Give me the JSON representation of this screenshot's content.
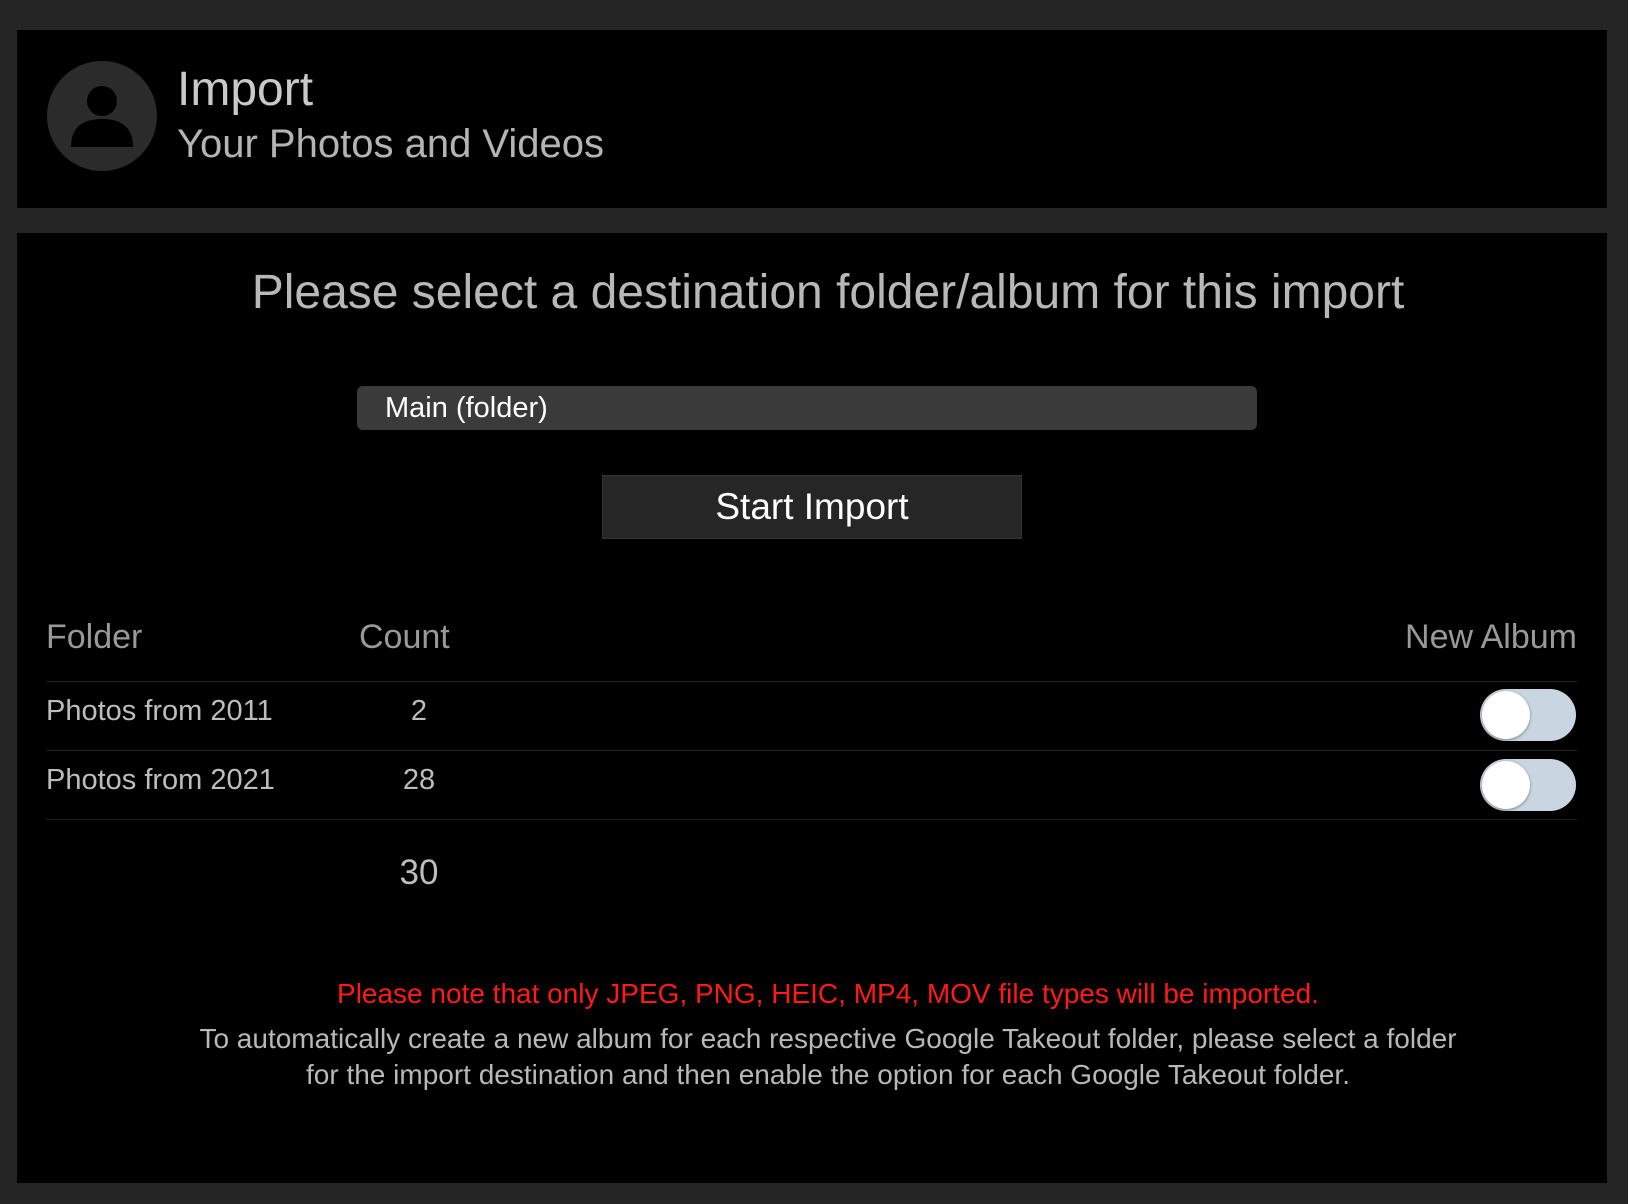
{
  "header": {
    "title": "Import",
    "subtitle": "Your Photos and Videos",
    "avatar_icon": "user-icon"
  },
  "main": {
    "prompt": "Please select a destination folder/album for this import",
    "destination": {
      "selected": "Main (folder)"
    },
    "start_button_label": "Start Import",
    "table": {
      "columns": [
        "Folder",
        "Count",
        "New Album"
      ],
      "rows": [
        {
          "folder": "Photos from 2011",
          "count": "2",
          "new_album": false
        },
        {
          "folder": "Photos from 2021",
          "count": "28",
          "new_album": false
        }
      ],
      "total": "30"
    },
    "warning": "Please note that only JPEG, PNG, HEIC, MP4, MOV file types will be imported.",
    "hint_lines": [
      "To automatically create a new album for each respective Google Takeout folder, please select a folder",
      "for the import destination and then enable the option for each Google Takeout folder."
    ]
  },
  "colors": {
    "background": "#252525",
    "panel": "#000000",
    "warning": "#ff1a1a",
    "toggle_track": "#c9d6e1"
  }
}
